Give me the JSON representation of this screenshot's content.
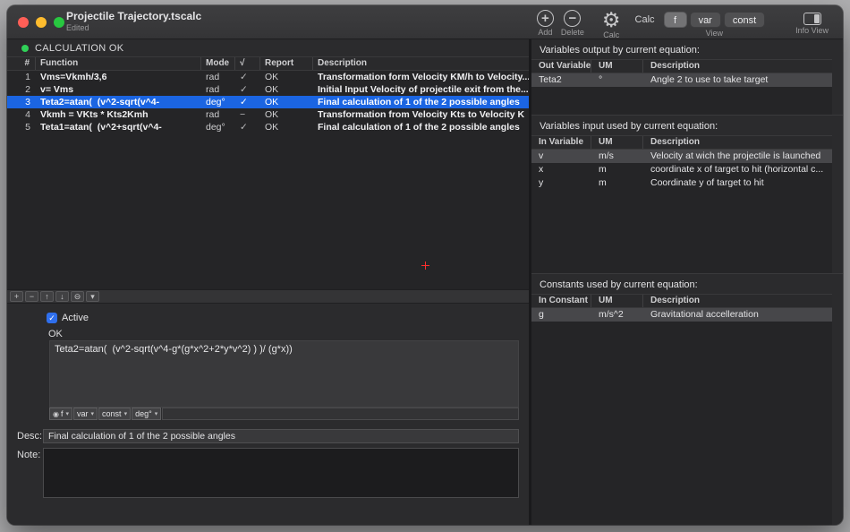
{
  "window": {
    "title": "Projectile Trajectory.tscalc",
    "subtitle": "Edited"
  },
  "toolbar": {
    "add_glyph": "+",
    "add_label": "Add",
    "delete_glyph": "−",
    "delete_label": "Delete",
    "gear_glyph": "⚙",
    "gear_label": "Calc",
    "calc_text": "Calc",
    "segments": [
      "f",
      "var",
      "const"
    ],
    "selected_segment": "f",
    "view_label": "View",
    "info_label": "Info View"
  },
  "status": {
    "text": "CALCULATION OK"
  },
  "function_table": {
    "headers": {
      "num": "#",
      "function": "Function",
      "mode": "Mode",
      "check": "√",
      "report": "Report",
      "description": "Description"
    },
    "rows": [
      {
        "num": "1",
        "function": "Vms=Vkmh/3,6",
        "mode": "rad",
        "check": "✓",
        "report": "OK",
        "description": "Transformation form Velocity KM/h to Velocity...",
        "selected": false
      },
      {
        "num": "2",
        "function": "v= Vms",
        "mode": "rad",
        "check": "✓",
        "report": "OK",
        "description": "Initial Input Velocity of projectile exit from the...",
        "selected": false
      },
      {
        "num": "3",
        "function": "Teta2=atan(  (v^2-sqrt(v^4-",
        "mode": "deg°",
        "check": "✓",
        "report": "OK",
        "description": "Final calculation of 1 of the 2 possible angles",
        "selected": true
      },
      {
        "num": "4",
        "function": "Vkmh = VKts * Kts2Kmh",
        "mode": "rad",
        "check": "−",
        "report": "OK",
        "description": "Transformation from Velocity Kts to Velocity K",
        "selected": false
      },
      {
        "num": "5",
        "function": "Teta1=atan(  (v^2+sqrt(v^4-",
        "mode": "deg°",
        "check": "✓",
        "report": "OK",
        "description": "Final calculation of 1 of the 2 possible angles",
        "selected": false
      }
    ]
  },
  "editor": {
    "toolbar_buttons": [
      {
        "name": "add-row-button",
        "glyph": "+"
      },
      {
        "name": "remove-row-button",
        "glyph": "−"
      },
      {
        "name": "move-up-button",
        "glyph": "↑"
      },
      {
        "name": "move-down-button",
        "glyph": "↓"
      },
      {
        "name": "disable-row-button",
        "glyph": "⊖"
      },
      {
        "name": "more-options-button",
        "glyph": "▾"
      }
    ],
    "active_label": "Active",
    "checkbox_glyph": "✓",
    "status": "OK",
    "formula": "Teta2=atan(  (v^2-sqrt(v^4-g*(g*x^2+2*y*v^2) ) )/ (g*x))",
    "dropdowns": [
      {
        "name": "f-dropdown",
        "label": "f",
        "icon_glyph": "◉"
      },
      {
        "name": "var-dropdown",
        "label": "var"
      },
      {
        "name": "const-dropdown",
        "label": "const"
      },
      {
        "name": "angle-mode-dropdown",
        "label": "deg°"
      }
    ],
    "desc_label": "Desc:",
    "desc_value": "Final calculation of 1 of the 2 possible angles",
    "note_label": "Note:",
    "note_value": ""
  },
  "right_panel": {
    "output_section": {
      "title": "Variables output by current equation:",
      "headers": [
        "Out Variable",
        "UM",
        "Description"
      ],
      "rows": [
        {
          "name": "Teta2",
          "um": "°",
          "description": "Angle 2 to use to take target",
          "highlight": true
        }
      ]
    },
    "input_section": {
      "title": "Variables input used by current equation:",
      "headers": [
        "In Variable",
        "UM",
        "Description"
      ],
      "rows": [
        {
          "name": "v",
          "um": "m/s",
          "description": "Velocity at wich the projectile is launched",
          "highlight": true
        },
        {
          "name": "x",
          "um": "m",
          "description": "coordinate x of target to hit (horizontal c...",
          "highlight": false
        },
        {
          "name": "y",
          "um": "m",
          "description": "Coordinate y of target to hit",
          "highlight": false
        }
      ]
    },
    "constants_section": {
      "title": "Constants used by current equation:",
      "headers": [
        "In Constant",
        "UM",
        "Description"
      ],
      "rows": [
        {
          "name": "g",
          "um": "m/s^2",
          "description": "Gravitational accelleration",
          "highlight": true
        }
      ]
    }
  }
}
